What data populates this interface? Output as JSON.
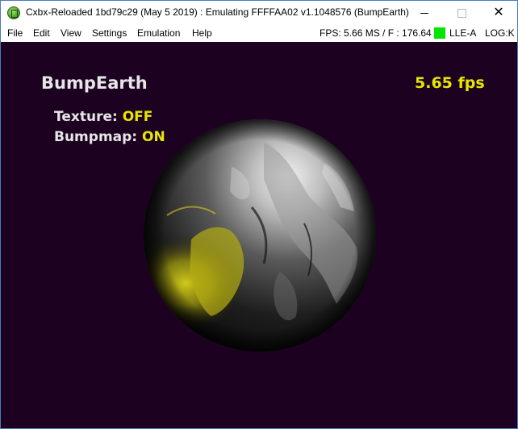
{
  "window": {
    "title": "Cxbx-Reloaded 1bd79c29 (May  5 2019) : Emulating FFFFAA02 v1.1048576 (BumpEarth)",
    "icon": "cxbx-app-icon",
    "controls": {
      "minimize": "minimize-icon",
      "maximize": "maximize-icon",
      "close": "close-icon",
      "close_glyph": "✕"
    }
  },
  "menubar": {
    "items": [
      {
        "label": "File"
      },
      {
        "label": "Edit"
      },
      {
        "label": "View"
      },
      {
        "label": "Settings"
      },
      {
        "label": "Emulation"
      },
      {
        "label": "Help"
      }
    ],
    "status": {
      "fps_text": "FPS: 5.66  MS / F : 176.64",
      "led_color": "#00e600",
      "lle_text": "LLE-A",
      "log_text": "LOG:K"
    }
  },
  "render": {
    "background": "#1c0220",
    "demo_title": "BumpEarth",
    "fps": "5.65 fps",
    "options": {
      "texture_label": "Texture:",
      "texture_value": "OFF",
      "bumpmap_label": "Bumpmap:",
      "bumpmap_value": "ON"
    },
    "colors": {
      "label": "#e6e6e6",
      "value": "#e6e600"
    }
  }
}
